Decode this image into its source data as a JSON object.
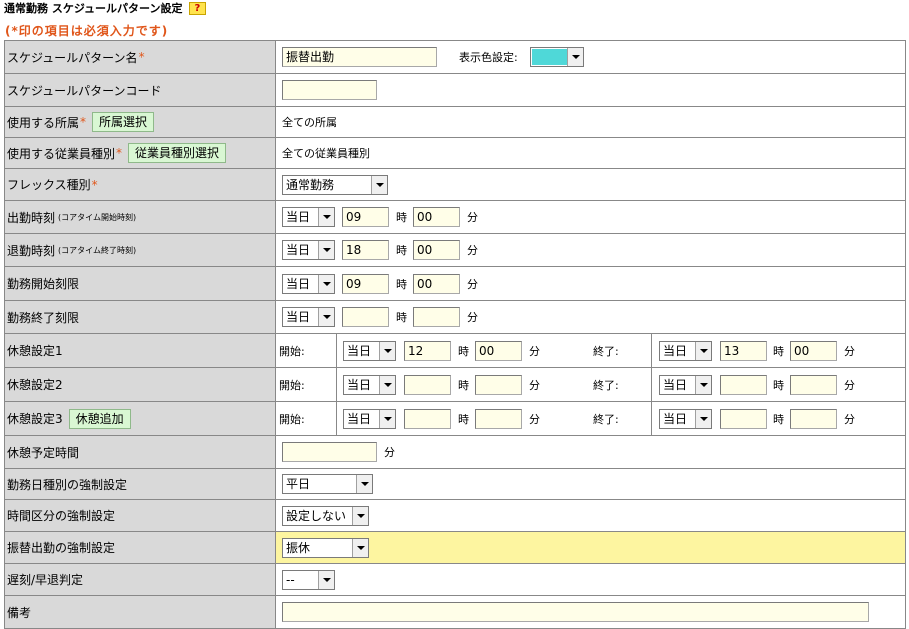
{
  "header": {
    "title": "通常勤務 スケジュールパターン設定",
    "help_label": "?",
    "required_note": "(*印の項目は必須入力です)"
  },
  "required_mark": "*",
  "colors": {
    "display_color": "#4fd8d8",
    "required": "#e0561a",
    "highlight_row": "#fdf5a0",
    "label_bg": "#d9d9d9",
    "input_bg": "#fffee8",
    "button_bg": "#d9f7d3"
  },
  "units": {
    "hour": "時",
    "minute": "分"
  },
  "day_option": "当日",
  "fields": {
    "pattern_name": {
      "label": "スケジュールパターン名",
      "value": "振替出勤",
      "color_label": "表示色設定:"
    },
    "pattern_code": {
      "label": "スケジュールパターンコード",
      "value": ""
    },
    "department": {
      "label": "使用する所属",
      "button": "所属選択",
      "value": "全ての所属"
    },
    "employee_type": {
      "label": "使用する従業員種別",
      "button": "従業員種別選択",
      "value": "全ての従業員種別"
    },
    "flex_type": {
      "label": "フレックス種別",
      "value": "通常勤務"
    },
    "start_time": {
      "label": "出勤時刻",
      "note": "(コアタイム開始時刻)",
      "hour": "09",
      "minute": "00"
    },
    "end_time": {
      "label": "退勤時刻",
      "note": "(コアタイム終了時刻)",
      "hour": "18",
      "minute": "00"
    },
    "work_start_limit": {
      "label": "勤務開始刻限",
      "hour": "09",
      "minute": "00"
    },
    "work_end_limit": {
      "label": "勤務終了刻限",
      "hour": "",
      "minute": ""
    },
    "break_start_label": "開始:",
    "break_end_label": "終了:",
    "breaks": [
      {
        "label": "休憩設定1",
        "start_hour": "12",
        "start_minute": "00",
        "end_hour": "13",
        "end_minute": "00"
      },
      {
        "label": "休憩設定2",
        "start_hour": "",
        "start_minute": "",
        "end_hour": "",
        "end_minute": ""
      },
      {
        "label": "休憩設定3",
        "button": "休憩追加",
        "start_hour": "",
        "start_minute": "",
        "end_hour": "",
        "end_minute": ""
      }
    ],
    "planned_break": {
      "label": "休憩予定時間",
      "value": ""
    },
    "workday_type": {
      "label": "勤務日種別の強制設定",
      "value": "平日"
    },
    "time_category": {
      "label": "時間区分の強制設定",
      "value": "設定しない"
    },
    "substitute": {
      "label": "振替出勤の強制設定",
      "value": "振休"
    },
    "late_early": {
      "label": "遅刻/早退判定",
      "value": "--"
    },
    "remarks": {
      "label": "備考",
      "value": ""
    }
  }
}
